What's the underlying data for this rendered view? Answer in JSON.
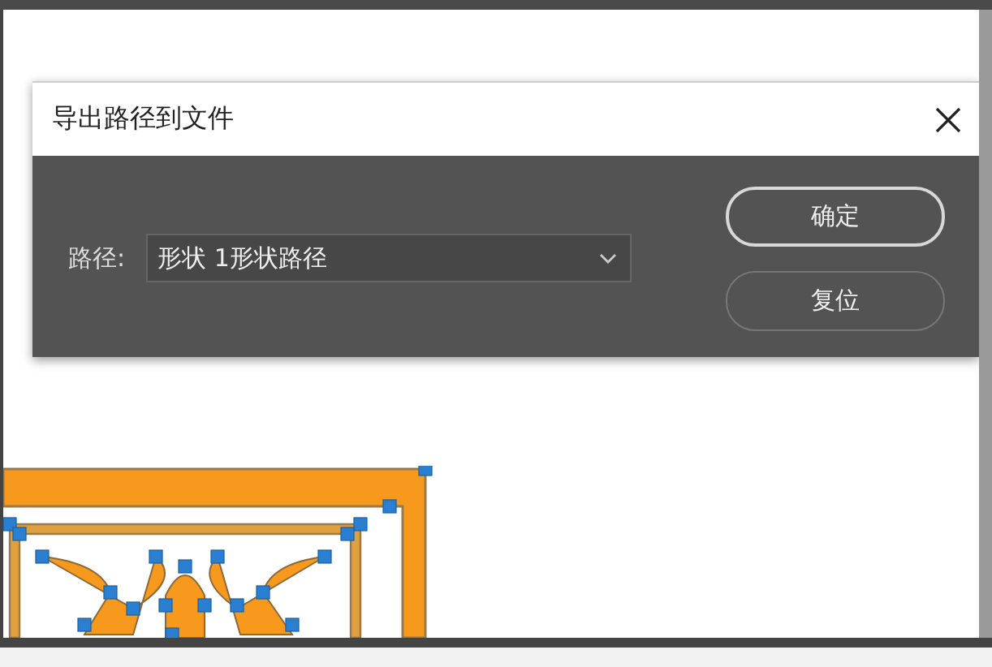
{
  "dialog": {
    "title": "导出路径到文件",
    "path_label": "路径:",
    "path_select": {
      "value": "形状 1形状路径"
    },
    "buttons": [
      {
        "label": "确定",
        "default": true
      },
      {
        "label": "复位",
        "default": false
      }
    ]
  }
}
